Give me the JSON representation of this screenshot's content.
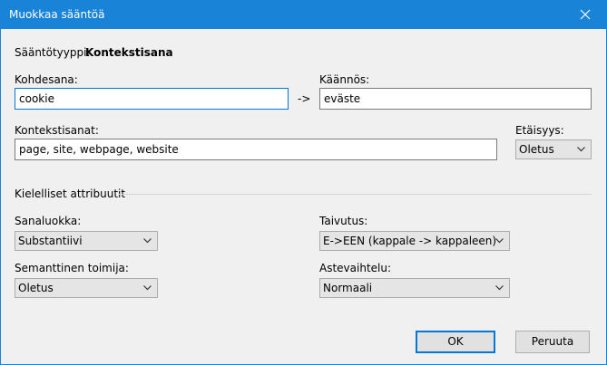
{
  "window": {
    "title": "Muokkaa sääntöä"
  },
  "rule_type": {
    "label": "Sääntötyyppi:",
    "value": "Kontekstisana"
  },
  "target_word": {
    "label": "Kohdesana:",
    "value": "cookie"
  },
  "arrow": "->",
  "translation": {
    "label": "Käännös:",
    "value": "eväste"
  },
  "context_words": {
    "label": "Kontekstisanat:",
    "value": "page, site, webpage, website"
  },
  "distance": {
    "label": "Etäisyys:",
    "value": "Oletus"
  },
  "linguistic_section": {
    "label": "Kielelliset attribuutit"
  },
  "word_class": {
    "label": "Sanaluokka:",
    "value": "Substantiivi"
  },
  "inflection": {
    "label": "Taivutus:",
    "value": "E->EEN (kappale -> kappaleen)"
  },
  "semantic_agent": {
    "label": "Semanttinen toimija:",
    "value": "Oletus"
  },
  "gradation": {
    "label": "Astevaihtelu:",
    "value": "Normaali"
  },
  "buttons": {
    "ok": "OK",
    "cancel": "Peruuta"
  },
  "colors": {
    "titlebar": "#1883d7",
    "focus": "#0078d7",
    "dialog_bg": "#f0f0f0"
  }
}
